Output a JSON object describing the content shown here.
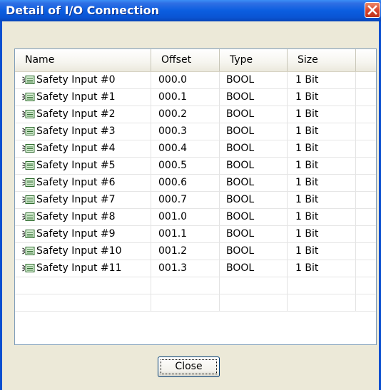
{
  "window": {
    "title": "Detail of I/O Connection"
  },
  "table": {
    "columns": [
      "Name",
      "Offset",
      "Type",
      "Size"
    ],
    "row_icon": "io-tag-icon",
    "rows": [
      {
        "name": "Safety Input #0",
        "offset": "000.0",
        "type": "BOOL",
        "size": "1 Bit"
      },
      {
        "name": "Safety Input #1",
        "offset": "000.1",
        "type": "BOOL",
        "size": "1 Bit"
      },
      {
        "name": "Safety Input #2",
        "offset": "000.2",
        "type": "BOOL",
        "size": "1 Bit"
      },
      {
        "name": "Safety Input #3",
        "offset": "000.3",
        "type": "BOOL",
        "size": "1 Bit"
      },
      {
        "name": "Safety Input #4",
        "offset": "000.4",
        "type": "BOOL",
        "size": "1 Bit"
      },
      {
        "name": "Safety Input #5",
        "offset": "000.5",
        "type": "BOOL",
        "size": "1 Bit"
      },
      {
        "name": "Safety Input #6",
        "offset": "000.6",
        "type": "BOOL",
        "size": "1 Bit"
      },
      {
        "name": "Safety Input #7",
        "offset": "000.7",
        "type": "BOOL",
        "size": "1 Bit"
      },
      {
        "name": "Safety Input #8",
        "offset": "001.0",
        "type": "BOOL",
        "size": "1 Bit"
      },
      {
        "name": "Safety Input #9",
        "offset": "001.1",
        "type": "BOOL",
        "size": "1 Bit"
      },
      {
        "name": "Safety Input #10",
        "offset": "001.2",
        "type": "BOOL",
        "size": "1 Bit"
      },
      {
        "name": "Safety Input #11",
        "offset": "001.3",
        "type": "BOOL",
        "size": "1 Bit"
      }
    ],
    "empty_rows": 2
  },
  "buttons": {
    "close_label": "Close"
  },
  "colors": {
    "titlebar": "#0a55d4",
    "close_box": "#d6422a",
    "dialog_bg": "#ece9d8"
  }
}
